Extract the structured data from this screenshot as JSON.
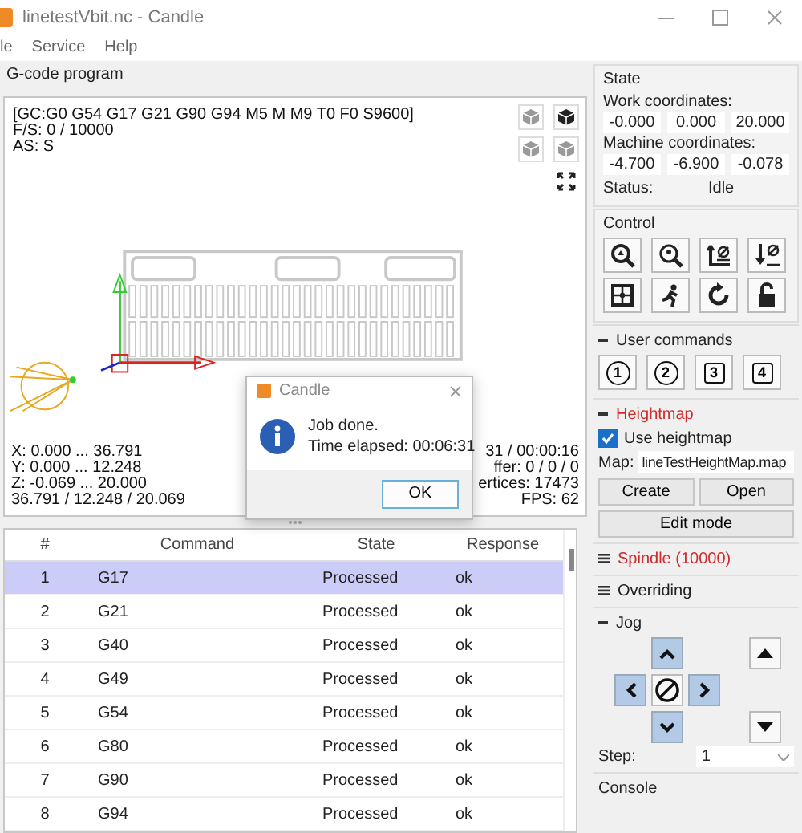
{
  "window": {
    "title": "linetestVbit.nc - Candle"
  },
  "menu": [
    {
      "label": "le"
    },
    {
      "label": "Service"
    },
    {
      "label": "Help"
    }
  ],
  "gcode_program": {
    "title": "G-code program",
    "info_lines": [
      "[GC:G0 G54 G17 G21 G90 G94 M5 M M9 T0 F0 S9600]",
      "F/S: 0 / 10000",
      "AS: S"
    ],
    "bounds_lines": [
      "X: 0.000 ... 36.791",
      "Y: 0.000 ... 12.248",
      "Z: -0.069 ... 20.000",
      "36.791 / 12.248 / 20.069"
    ],
    "stats_lines": [
      "31 / 00:00:16",
      "ffer: 0 / 0 / 0",
      "ertices: 17473",
      "FPS: 62"
    ]
  },
  "dialog": {
    "title": "Candle",
    "message_lines": [
      "Job done.",
      "Time elapsed: 00:06:31"
    ],
    "button": "OK"
  },
  "table": {
    "columns": [
      "#",
      "Command",
      "State",
      "Response"
    ],
    "rows": [
      {
        "cells": [
          "1",
          "G17",
          "Processed",
          "ok"
        ],
        "selected": true
      },
      {
        "cells": [
          "2",
          "G21",
          "Processed",
          "ok"
        ],
        "selected": false
      },
      {
        "cells": [
          "3",
          "G40",
          "Processed",
          "ok"
        ],
        "selected": false
      },
      {
        "cells": [
          "4",
          "G49",
          "Processed",
          "ok"
        ],
        "selected": false
      },
      {
        "cells": [
          "5",
          "G54",
          "Processed",
          "ok"
        ],
        "selected": false
      },
      {
        "cells": [
          "6",
          "G80",
          "Processed",
          "ok"
        ],
        "selected": false
      },
      {
        "cells": [
          "7",
          "G90",
          "Processed",
          "ok"
        ],
        "selected": false
      },
      {
        "cells": [
          "8",
          "G94",
          "Processed",
          "ok"
        ],
        "selected": false
      }
    ]
  },
  "state": {
    "title": "State",
    "work_label": "Work coordinates:",
    "work": [
      "-0.000",
      "0.000",
      "20.000"
    ],
    "machine_label": "Machine coordinates:",
    "machine": [
      "-4.700",
      "-6.900",
      "-0.078"
    ],
    "status_label": "Status:",
    "status": "Idle"
  },
  "control": {
    "title": "Control"
  },
  "user_commands": {
    "title": "User commands",
    "expanded": true,
    "highlighted": false,
    "buttons": [
      {
        "label": "1",
        "kind": "circle"
      },
      {
        "label": "2",
        "kind": "circle"
      },
      {
        "label": "3",
        "kind": "square"
      },
      {
        "label": "4",
        "kind": "square"
      }
    ]
  },
  "heightmap": {
    "title": "Heightmap",
    "expanded": true,
    "highlighted": true,
    "use_heightmap": {
      "label": "Use heightmap",
      "checked": true
    },
    "map_label": "Map:",
    "map_value": "lineTestHeightMap.map",
    "buttons": [
      "Create",
      "Open",
      "Edit mode"
    ]
  },
  "spindle": {
    "title": "Spindle (10000)",
    "expanded": false,
    "highlighted": true
  },
  "overriding": {
    "title": "Overriding",
    "expanded": false,
    "highlighted": false
  },
  "jog": {
    "title": "Jog",
    "expanded": true,
    "highlighted": false,
    "step_label": "Step:",
    "step": "1"
  },
  "console": {
    "title": "Console"
  }
}
